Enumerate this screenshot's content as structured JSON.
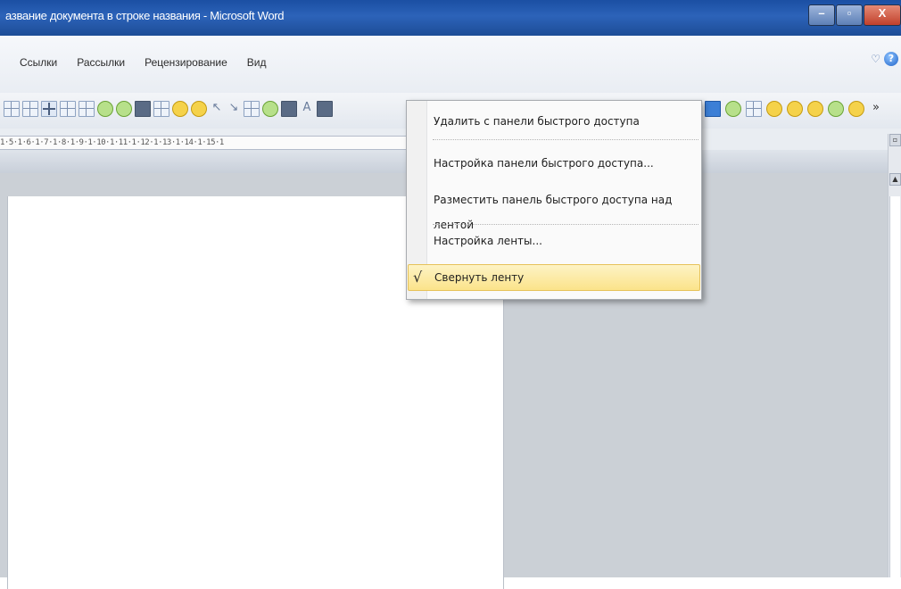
{
  "window": {
    "title": "азвание документа в строке названия  -  Microsoft Word",
    "minimize_glyph": "–",
    "maximize_glyph": "▫",
    "close_glyph": "X"
  },
  "ribbon": {
    "tabs": [
      {
        "label": "Ссылки"
      },
      {
        "label": "Рассылки"
      },
      {
        "label": "Рецензирование"
      },
      {
        "label": "Вид"
      }
    ],
    "heart_icon": "♡",
    "help_icon": "?"
  },
  "ruler": {
    "scale_text": "1·5·1·6·1·7·1·8·1·9·1·10·1·11·1·12·1·13·1·14·1·15·1"
  },
  "context_menu": {
    "items": [
      {
        "label": "Удалить с панели быстрого доступа",
        "checked": false,
        "selected": false
      },
      {
        "label": "Настройка панели быстрого доступа...",
        "checked": false,
        "selected": false
      },
      {
        "label": "Разместить панель быстрого доступа над лентой",
        "checked": false,
        "selected": false
      },
      {
        "label": "Настройка ленты...",
        "checked": false,
        "selected": false
      },
      {
        "label": "Свернуть ленту",
        "checked": true,
        "selected": true
      }
    ],
    "check_glyph": "√"
  },
  "colors": {
    "titlebar": "#1d4f9e",
    "menu_highlight": "#fbe38a",
    "doc_background": "#cbd0d6"
  }
}
